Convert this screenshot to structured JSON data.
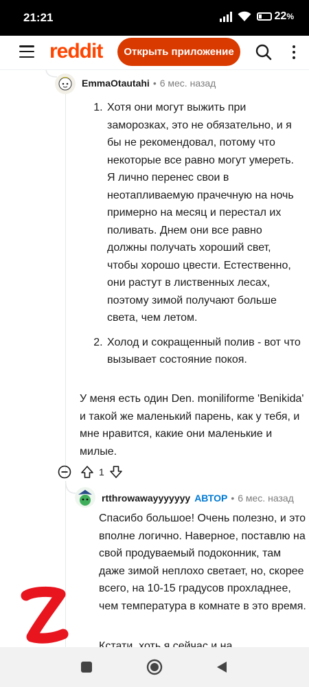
{
  "status": {
    "time": "21:21",
    "battery": "22"
  },
  "header": {
    "logo_text": "reddit",
    "open_app_label": "Открыть приложение"
  },
  "comment1": {
    "author": "EmmaOtautahi",
    "time": "6 мес. назад",
    "list_items": [
      "Хотя они могут выжить при заморозках, это не обязательно, и я бы не рекомендовал, потому что некоторые все равно могут умереть. Я лично перенес свои в неотапливаемую прачечную на ночь примерно на месяц и перестал их поливать. Днем они все равно должны получать хороший свет, чтобы хорошо цвести. Естественно, они растут в лиственных лесах, поэтому зимой получают больше света, чем летом.",
      "Холод и сокращенный полив - вот что вызывает состояние покоя."
    ],
    "paragraph": "У меня есть один Den. moniliforme 'Benikida' и такой же маленький парень, как у тебя, и мне нравится, какие они маленькие и милые.",
    "score": "1"
  },
  "comment2": {
    "author": "rtthrowawayyyyyyy",
    "op_badge": "АВТОР",
    "time": "6 мес. назад",
    "paragraph1": "Спасибо большое! Очень полезно, и это вполне логично. Наверное, поставлю на свой продуваемый подоконник, там даже зимой неплохо светает, но, скорее всего, на 10-15 градусов прохладнее, чем температура в комнате в это время.",
    "paragraph2": "Кстати, хоть я сейчас и на"
  },
  "colors": {
    "brand": "#ff4500",
    "button": "#d93a00",
    "op": "#0079d3",
    "watermark": "#e8141e"
  }
}
